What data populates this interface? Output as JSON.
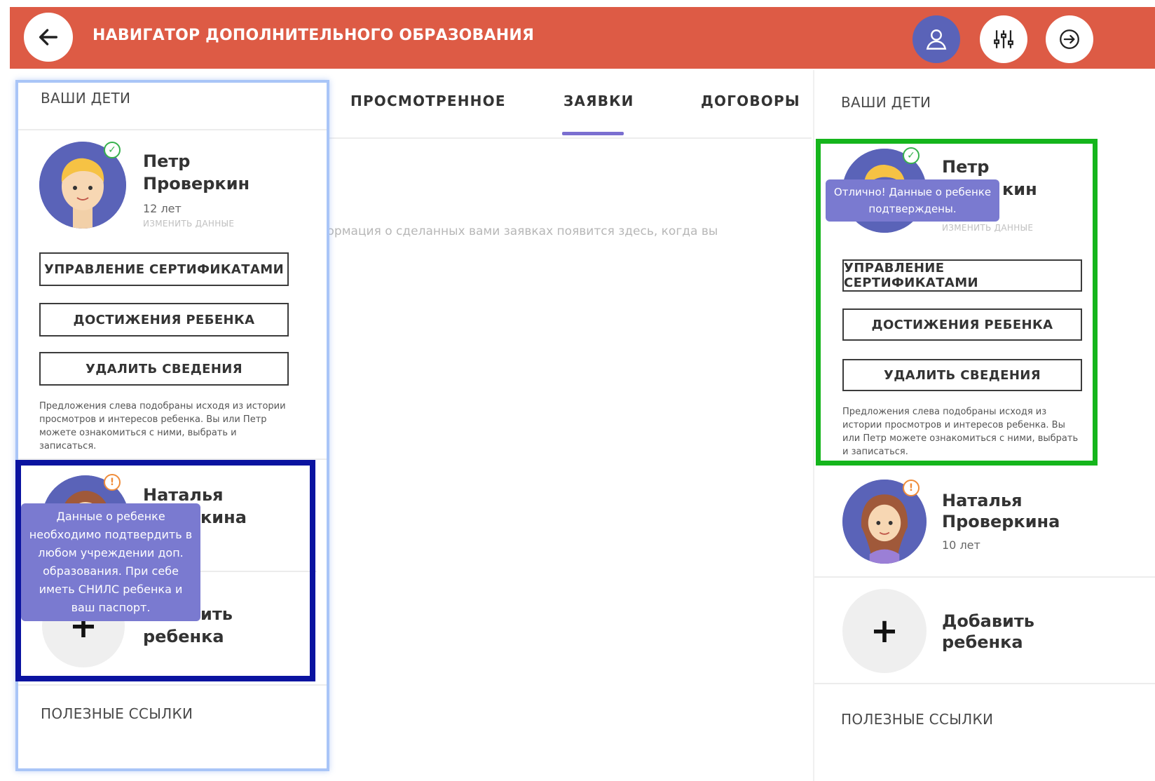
{
  "header": {
    "title": "НАВИГАТОР ДОПОЛНИТЕЛЬНОГО ОБРАЗОВАНИЯ",
    "bg_color": "#dd5b45",
    "icons": [
      "arrow-left-icon",
      "user-icon",
      "sliders-icon",
      "logout-icon"
    ]
  },
  "tabs": [
    {
      "label": "ПРОСМОТРЕННОЕ",
      "active": false
    },
    {
      "label": "ЗАЯВКИ",
      "active": true
    },
    {
      "label": "ДОГОВОРЫ",
      "active": false
    }
  ],
  "main": {
    "empty_message": "формация о сделанных вами заявках появится здесь, когда вы"
  },
  "left_panel": {
    "title": "ВАШИ ДЕТИ",
    "child1": {
      "first_name": "Петр",
      "last_name": "Проверкин",
      "age": "12 лет",
      "edit_link": "ИЗМЕНИТЬ ДАННЫЕ",
      "status": "verified"
    },
    "buttons": {
      "certificates": "УПРАВЛЕНИЕ СЕРТИФИКАТАМИ",
      "achievements": "ДОСТИЖЕНИЯ РЕБЕНКА",
      "delete": "УДАЛИТЬ СВЕДЕНИЯ"
    },
    "hint": "Предложения слева подобраны исходя из истории просмотров и интересов ребенка. Вы или Петр можете ознакомиться с ними, выбрать и записаться.",
    "child2": {
      "first_name": "Наталья",
      "last_name_visible": "кина",
      "status": "unverified"
    },
    "tooltip_unverified": "Данные о ребенке необходимо подтвердить в любом учреждении доп. образования. При себе иметь СНИЛС ребенка и ваш паспорт.",
    "add_child_line1_visible": "ить",
    "add_child_line2": "ребенка",
    "useful_links": "ПОЛЕЗНЫЕ ССЫЛКИ"
  },
  "right_panel": {
    "title": "ВАШИ ДЕТИ",
    "child1": {
      "first_name": "Петр",
      "last_name_visible": "кин",
      "edit_link": "ИЗМЕНИТЬ ДАННЫЕ",
      "status": "verified"
    },
    "tooltip_verified": "Отлично! Данные о ребенке подтверждены.",
    "buttons": {
      "certificates": "УПРАВЛЕНИЕ СЕРТИФИКАТАМИ",
      "achievements": "ДОСТИЖЕНИЯ РЕБЕНКА",
      "delete": "УДАЛИТЬ СВЕДЕНИЯ"
    },
    "hint": "Предложения слева подобраны исходя из истории просмотров и интересов ребенка. Вы или Петр можете ознакомиться с ними, выбрать и записаться.",
    "child2": {
      "first_name": "Наталья",
      "last_name": "Проверкина",
      "age": "10 лет",
      "status": "unverified"
    },
    "add_child": {
      "line1": "Добавить",
      "line2": "ребенка",
      "plus": "+"
    },
    "useful_links": "ПОЛЕЗНЫЕ ССЫЛКИ"
  }
}
